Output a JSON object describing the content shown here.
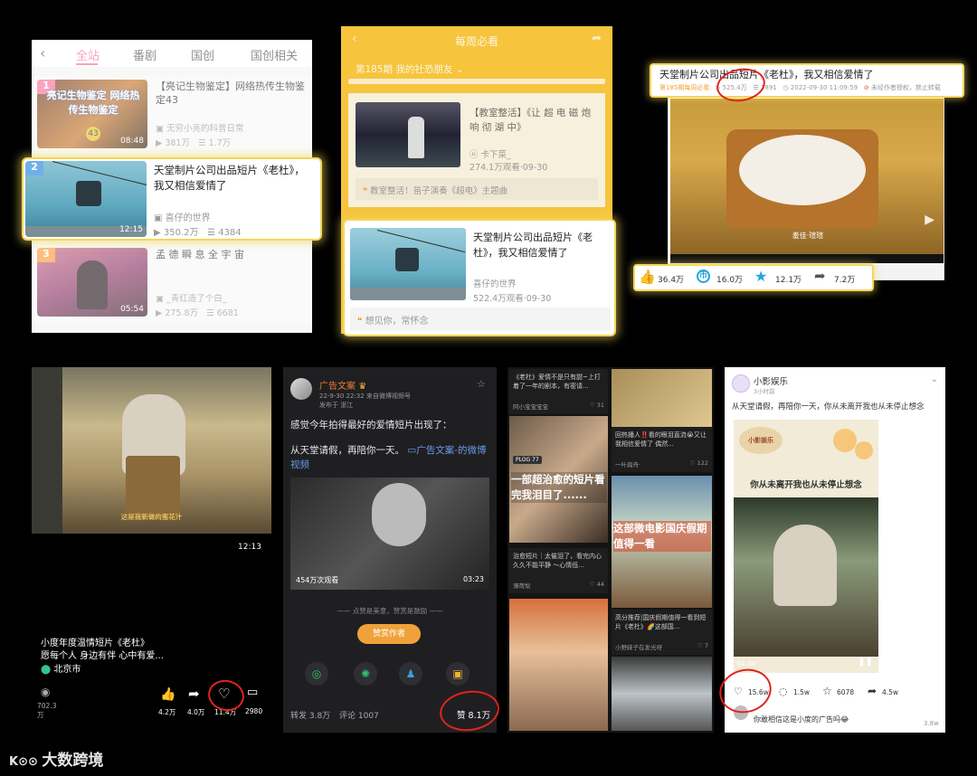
{
  "panel1": {
    "tabs": [
      "全站",
      "番剧",
      "国创",
      "国创相关"
    ],
    "rows": [
      {
        "rank": "1",
        "title": "【亮记生物鉴定】网络热传生物鉴定43",
        "thumb_text": "亮记生物鉴定 网络热传生物鉴定",
        "duration": "08:48",
        "up": "无穷小亮的科普日常",
        "views": "381万",
        "comments": "1.7万"
      },
      {
        "rank": "3",
        "title": "孟 德 瞬 息 全 宇 宙",
        "duration": "05:54",
        "up": "_青红造了个白_",
        "views": "275.8万",
        "comments": "6681"
      }
    ],
    "highlight": {
      "rank": "2",
      "title": "天堂制片公司出品短片《老杜》，我又相信爱情了",
      "duration": "12:15",
      "up": "喜仔的世界",
      "views": "350.2万",
      "comments": "4384"
    }
  },
  "panel2": {
    "header": "每周必看",
    "issue": "第185期 我的社恐朋友",
    "item": {
      "title": "【教室整活】《让 超 电 磁 炮 响 彻 湖 中》",
      "up": "卡下菜_",
      "meta": "274.1万观看·09-30",
      "note": "教室整活！苗子演奏《超电》主题曲"
    },
    "highlight": {
      "title": "天堂制片公司出品短片《老杜》，我又相信爱情了",
      "up": "喜仔的世界",
      "meta": "522.4万观看·09-30",
      "note": "想见你，常怀念"
    }
  },
  "panel3": {
    "title": "天堂制片公司出品短片《老杜》，我又相信爱情了",
    "meta_tag": "第185期每周必看",
    "views": "525.4万",
    "danmaku": "1891",
    "date": "2022-09-30 11:09:59",
    "rights": "未经作者授权，禁止转载",
    "video_caption": "羞佳·瑄瑄",
    "stats": {
      "likes": "36.4万",
      "coins": "16.0万",
      "favs": "12.1万",
      "shares": "7.2万"
    }
  },
  "panel4": {
    "subtitle": "这是我新做的蛋花汁",
    "duration": "12:13",
    "title": "小度年度温情短片《老杜》",
    "desc": "愿每个人 身边有伴 心中有爱...",
    "location": "北京市",
    "plays": "702.3万",
    "likes": "4.2万",
    "shares": "4.0万",
    "favs": "11.4万",
    "comments": "2980"
  },
  "panel5": {
    "name": "广告文案",
    "time": "22-9-30 22:32 来自微博视频号",
    "from": "发布于 浙江",
    "text1": "感觉今年拍得最好的爱情短片出现了：",
    "text2": "从天堂请假，再陪你一天。",
    "link": "广告文案-的微博视频",
    "plays": "454万次观看",
    "duration": "03:23",
    "tip": "点赞是美意，赞赏是鼓励",
    "reward": "赞赏作者",
    "reposts": "转发 3.8万",
    "comments": "评论 1007",
    "likes": "赞 8.1万"
  },
  "panel6": {
    "cards": [
      {
        "title": "《老杜》爱情不是只有甜~上打着了一年的剧本，有密请...",
        "user": "阿小宝宝宝宝",
        "count": "31"
      },
      {
        "title": "回热播人‼️看的眼泪直流😭又让我相信爱情了 偶然...",
        "user": "一叶扁舟·",
        "count": "122"
      },
      {
        "overlay": "一部超治愈的短片看完我泪目了......",
        "title": "治愈短片｜太催泪了，看完内心久久不能平静 ～心情低...",
        "user": "薄荷梨",
        "count": "44"
      },
      {
        "overlay": "这部微电影国庆假期值得一看",
        "title": "高分推荐|国庆假期值得一看到短片《老杜》🌈这部国...",
        "user": "小野妹子在发光呀",
        "count": "7"
      }
    ],
    "small_tag": "PLOG 77"
  },
  "panel7": {
    "name": "小影娱乐",
    "time": "3小时前",
    "text": "从天堂请假，再陪你一天，你从未离开我也从未停止想念",
    "banner": "你从未离开我也从未停止想念",
    "logo": "小影娱乐",
    "video_time": "01:34",
    "likes": "15.6w",
    "comments": "1.5w",
    "favs": "6078",
    "shares": "4.5w",
    "comment_text": "你敢相信这是小度的广告吗😂",
    "comment_count": "3.8w"
  },
  "watermark": "大数跨境"
}
